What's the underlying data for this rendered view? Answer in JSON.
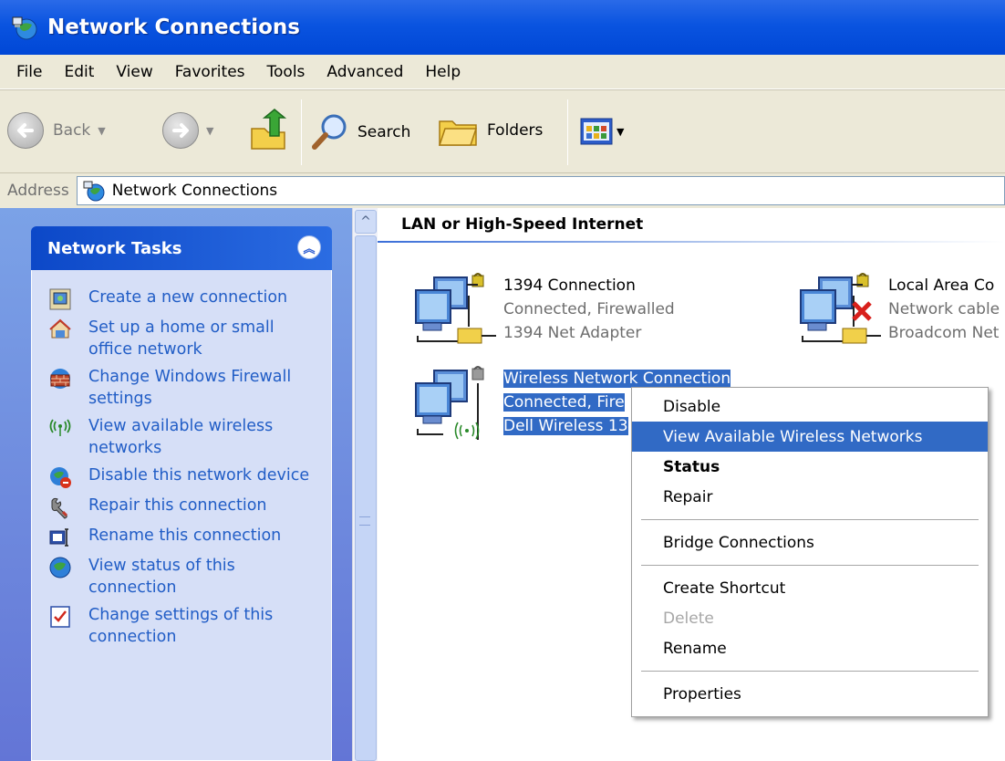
{
  "window": {
    "title": "Network Connections",
    "title_icon": "network-connections-icon"
  },
  "menu": [
    "File",
    "Edit",
    "View",
    "Favorites",
    "Tools",
    "Advanced",
    "Help"
  ],
  "toolbar": {
    "back_label": "Back",
    "search_label": "Search",
    "folders_label": "Folders"
  },
  "address": {
    "label": "Address",
    "value": "Network Connections"
  },
  "tasks": {
    "title": "Network Tasks",
    "items": [
      {
        "icon": "new-connection-icon",
        "label": "Create a new connection"
      },
      {
        "icon": "home-network-icon",
        "label": "Set up a home or small office network"
      },
      {
        "icon": "firewall-icon",
        "label": "Change Windows Firewall settings"
      },
      {
        "icon": "wireless-icon",
        "label": "View available wireless networks"
      },
      {
        "icon": "disable-device-icon",
        "label": "Disable this network device"
      },
      {
        "icon": "repair-icon",
        "label": "Repair this connection"
      },
      {
        "icon": "rename-icon",
        "label": "Rename this connection"
      },
      {
        "icon": "status-icon",
        "label": "View status of this connection"
      },
      {
        "icon": "settings-icon",
        "label": "Change settings of this connection"
      }
    ]
  },
  "group": {
    "title": "LAN or High-Speed Internet"
  },
  "connections": [
    {
      "name": "1394 Connection",
      "status": "Connected, Firewalled",
      "device": "1394 Net Adapter"
    },
    {
      "name": "Local Area Co",
      "status": "Network cable",
      "device": "Broadcom Net"
    },
    {
      "name": "Wireless Network Connection",
      "status": "Connected, Fire",
      "device": "Dell Wireless 13"
    }
  ],
  "context_menu": {
    "items": [
      "Disable",
      "View Available Wireless Networks",
      "Status",
      "Repair",
      "Bridge Connections",
      "Create Shortcut",
      "Delete",
      "Rename",
      "Properties"
    ],
    "highlighted": "View Available Wireless Networks",
    "disabled": [
      "Delete"
    ],
    "default": "Status"
  },
  "colors": {
    "title_bar": "#0a54e0",
    "selection": "#316ac5",
    "task_link": "#215dc6"
  }
}
